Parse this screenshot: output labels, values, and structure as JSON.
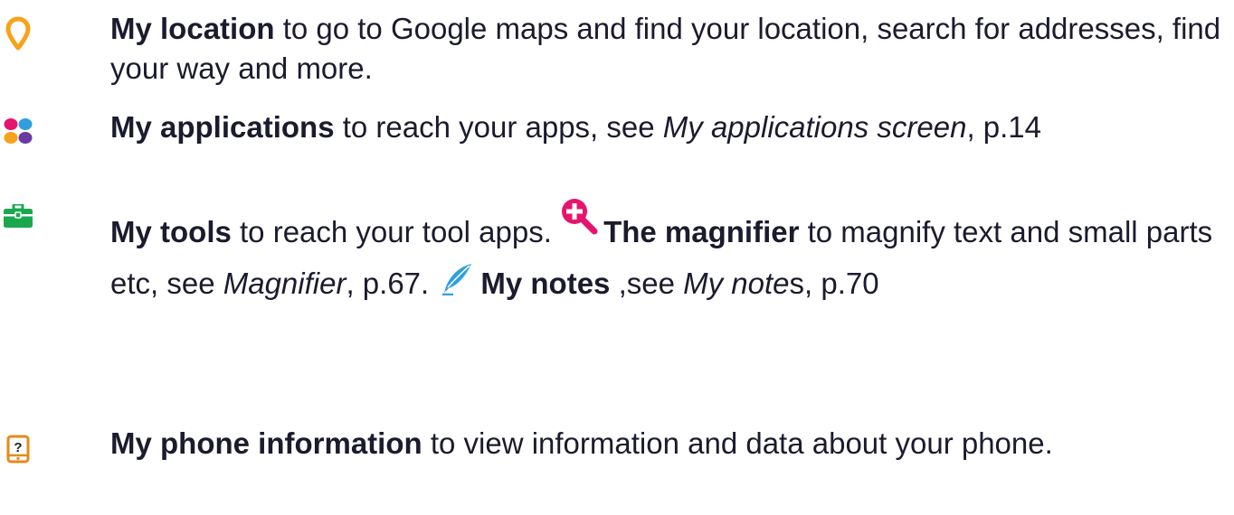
{
  "colors": {
    "location_orange": "#f7a21b",
    "text": "#1b1b2e",
    "tools_green": "#1aa84f",
    "magnifier_pink": "#e6146f",
    "notes_blue": "#2f9fe0",
    "phone_orange": "#e58a1a"
  },
  "items": [
    {
      "icon": "location-pin-icon",
      "title": "My location",
      "desc": " to go to Google maps and find your location, search for addresses, find your way and more."
    },
    {
      "icon": "applications-grid-icon",
      "title": "My applications",
      "desc": " to reach your apps, see ",
      "ref": "My applications screen",
      "tail": ", p.14"
    },
    {
      "icon": "toolbox-icon",
      "title": "My tools",
      "desc": " to reach your tool apps. ",
      "sub1_icon": "magnifier-icon",
      "sub1_title": "The magnifier",
      "sub1_desc": " to magnify text and small parts etc, see ",
      "sub1_ref": "Magnifier",
      "sub1_tail": ", p.67. ",
      "sub2_icon": "quill-pen-icon",
      "sub2_title": "My notes",
      "sub2_desc": " ,see ",
      "sub2_ref": "My note",
      "sub2_ref_tail": "s",
      "sub2_tail": ", p.70"
    },
    {
      "icon": "phone-info-icon",
      "title": "My phone information",
      "desc": " to view information and data about your phone."
    }
  ]
}
